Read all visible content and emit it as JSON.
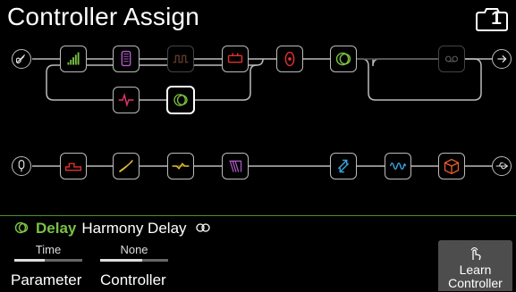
{
  "header": {
    "title": "Controller Assign",
    "snapshot_number": "1"
  },
  "signal_chain": {
    "path_a_row1": [
      "volume-pedal-block",
      "wah-block",
      "dynamics-block",
      "amp-block",
      "eq-block",
      "delay-block",
      "looper-block"
    ],
    "path_a_row2": [
      "modulation-block",
      "selected-delay-block"
    ],
    "path_b": [
      "split-block",
      "filter-block",
      "synth-block",
      "pitch-block",
      "reverb-block",
      "wave-block",
      "cab-block"
    ]
  },
  "selected_block": {
    "category": "Delay",
    "model": "Harmony Delay",
    "colors": {
      "category": "#7ac143"
    }
  },
  "parameters": {
    "slot1": {
      "value": "Time",
      "label": "Parameter",
      "level": 0.45
    },
    "slot2": {
      "value": "None",
      "label": "Controller",
      "level": 0.62
    }
  },
  "learn_button": {
    "line1": "Learn",
    "line2": "Controller"
  },
  "colors": {
    "background": "#000000",
    "divider": "#4c8f2e",
    "button": "#4d4d4d"
  }
}
